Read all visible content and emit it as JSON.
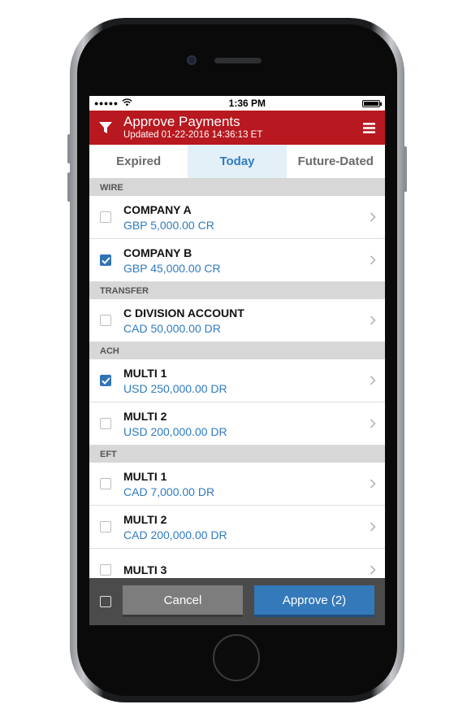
{
  "status_bar": {
    "time": "1:36 PM",
    "signal": "●●●●●"
  },
  "header": {
    "title": "Approve Payments",
    "subtitle": "Updated  01-22-2016 14:36:13 ET",
    "icons": [
      "filter-icon",
      "menu-icon"
    ]
  },
  "tabs": [
    {
      "label": "Expired",
      "active": false
    },
    {
      "label": "Today",
      "active": true
    },
    {
      "label": "Future-Dated",
      "active": false
    }
  ],
  "sections": [
    {
      "label": "WIRE",
      "items": [
        {
          "name": "COMPANY A",
          "amount": "GBP 5,000.00 CR",
          "checked": false
        },
        {
          "name": "COMPANY B",
          "amount": "GBP 45,000.00 CR",
          "checked": true
        }
      ]
    },
    {
      "label": "TRANSFER",
      "items": [
        {
          "name": "C DIVISION ACCOUNT",
          "amount": "CAD 50,000.00 DR",
          "checked": false
        }
      ]
    },
    {
      "label": "ACH",
      "items": [
        {
          "name": "MULTI 1",
          "amount": "USD 250,000.00 DR",
          "checked": true
        },
        {
          "name": "MULTI 2",
          "amount": "USD 200,000.00 DR",
          "checked": false
        }
      ]
    },
    {
      "label": "EFT",
      "items": [
        {
          "name": "MULTI 1",
          "amount": "CAD 7,000.00 DR",
          "checked": false
        },
        {
          "name": "MULTI 2",
          "amount": "CAD 200,000.00 DR",
          "checked": false
        },
        {
          "name": "MULTI 3",
          "amount": "",
          "checked": false
        }
      ]
    }
  ],
  "footer": {
    "cancel_label": "Cancel",
    "approve_label": "Approve (2)",
    "select_all_checked": false
  },
  "colors": {
    "header_red": "#b8181f",
    "accent_blue": "#2f7bbf",
    "approve_blue": "#3479b9"
  }
}
